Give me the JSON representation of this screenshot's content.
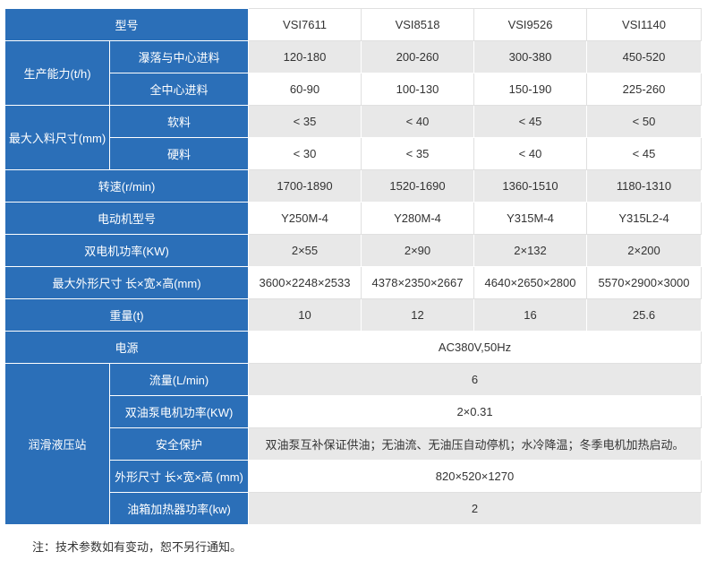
{
  "header": {
    "label": "型号",
    "models": [
      "VSI7611",
      "VSI8518",
      "VSI9526",
      "VSI1140"
    ]
  },
  "capacity": {
    "label": "生产能力(t/h)",
    "rows": [
      {
        "label": "瀑落与中心进料",
        "values": [
          "120-180",
          "200-260",
          "300-380",
          "450-520"
        ]
      },
      {
        "label": "全中心进料",
        "values": [
          "60-90",
          "100-130",
          "150-190",
          "225-260"
        ]
      }
    ]
  },
  "feed_size": {
    "label": "最大入料尺寸(mm)",
    "rows": [
      {
        "label": "软料",
        "values": [
          "< 35",
          "< 40",
          "< 45",
          "< 50"
        ]
      },
      {
        "label": "硬料",
        "values": [
          "< 30",
          "< 35",
          "< 40",
          "< 45"
        ]
      }
    ]
  },
  "rows": [
    {
      "label": "转速(r/min)",
      "values": [
        "1700-1890",
        "1520-1690",
        "1360-1510",
        "1180-1310"
      ]
    },
    {
      "label": "电动机型号",
      "values": [
        "Y250M-4",
        "Y280M-4",
        "Y315M-4",
        "Y315L2-4"
      ]
    },
    {
      "label": "双电机功率(KW)",
      "values": [
        "2×55",
        "2×90",
        "2×132",
        "2×200"
      ]
    },
    {
      "label": "最大外形尺寸 长×宽×高(mm)",
      "values": [
        "3600×2248×2533",
        "4378×2350×2667",
        "4640×2650×2800",
        "5570×2900×3000"
      ]
    },
    {
      "label": "重量(t)",
      "values": [
        "10",
        "12",
        "16",
        "25.6"
      ]
    }
  ],
  "power": {
    "label": "电源",
    "value": "AC380V,50Hz"
  },
  "lube": {
    "label": "润滑液压站",
    "rows": [
      {
        "label": "流量(L/min)",
        "value": "6"
      },
      {
        "label": "双油泵电机功率(KW)",
        "value": "2×0.31"
      },
      {
        "label": "安全保护",
        "value": "双油泵互补保证供油；无油流、无油压自动停机；水冷降温；冬季电机加热启动。"
      },
      {
        "label": "外形尺寸 长×宽×高 (mm)",
        "value": "820×520×1270"
      },
      {
        "label": "油箱加热器功率(kw)",
        "value": "2"
      }
    ]
  },
  "note": "注：技术参数如有变动，恕不另行通知。",
  "colors": {
    "header_blue": "#2b6fb8",
    "row_gray": "#e8e8e8",
    "text": "#333333"
  }
}
